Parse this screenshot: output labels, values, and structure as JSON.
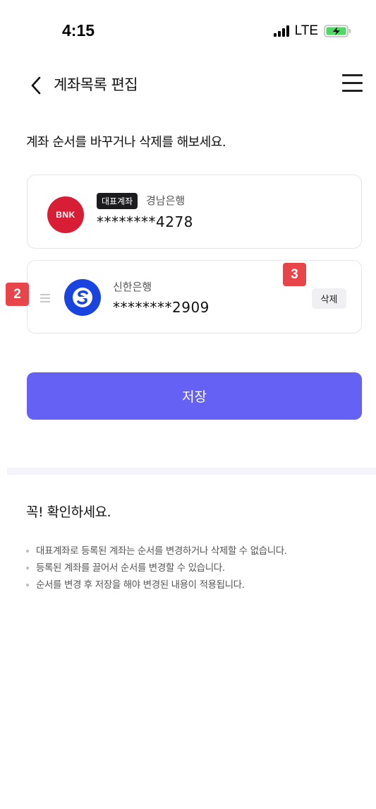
{
  "status": {
    "time": "4:15",
    "network": "LTE"
  },
  "header": {
    "title": "계좌목록 편집"
  },
  "instruction": "계좌 순서를 바꾸거나 삭제를 해보세요.",
  "accounts": [
    {
      "logo_text": "BNK",
      "badge": "대표계좌",
      "bank_name": "경남은행",
      "account_number": "********4278"
    },
    {
      "bank_name": "신한은행",
      "account_number": "********2909",
      "delete_label": "삭제"
    }
  ],
  "markers": {
    "drag": "2",
    "delete": "3"
  },
  "save_label": "저장",
  "notice": {
    "title": "꼭! 확인하세요.",
    "items": [
      "대표계좌로 등록된 계좌는 순서를 변경하거나 삭제할 수 없습니다.",
      "등록된 계좌를 끌어서 순서를 변경할 수 있습니다.",
      "순서를 변경 후 저장을 해야 변경된 내용이 적용됩니다."
    ]
  },
  "colors": {
    "primary": "#6561f4",
    "bnk_red": "#d71e35",
    "shinhan_blue": "#1a44e0",
    "marker_red": "#e8454a"
  },
  "icons": [
    "back-arrow-icon",
    "hamburger-menu-icon",
    "drag-handle-icon",
    "signal-icon",
    "battery-icon"
  ]
}
